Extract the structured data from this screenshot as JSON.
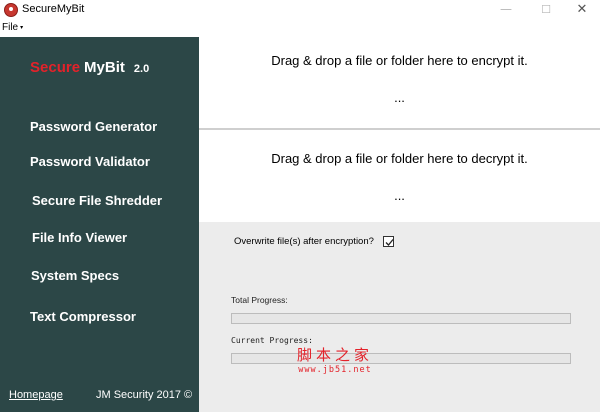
{
  "window": {
    "title": "SecureMyBit",
    "minimize_glyph": "—",
    "maximize_glyph": "☐",
    "close_glyph": "✕"
  },
  "menu": {
    "file_label": "File",
    "file_arrow": "▾"
  },
  "sidebar": {
    "brand_part1": "Secure",
    "brand_part2": "MyBit",
    "version": "2.0",
    "items": [
      {
        "label": "Password Generator"
      },
      {
        "label": "Password Validator"
      },
      {
        "label": "Secure File Shredder"
      },
      {
        "label": "File Info Viewer"
      },
      {
        "label": "System Specs"
      },
      {
        "label": "Text Compressor"
      }
    ],
    "homepage_label": "Homepage",
    "copyright": "JM Security 2017 ©"
  },
  "encrypt_zone": {
    "text": "Drag & drop a file or folder here to encrypt it.",
    "status": "..."
  },
  "decrypt_zone": {
    "text": "Drag & drop a file or folder here to decrypt it.",
    "status": "..."
  },
  "options": {
    "overwrite_label": "Overwrite file(s) after encryption?",
    "overwrite_checked": true
  },
  "progress": {
    "total_label": "Total Progress:",
    "total_value": 0,
    "current_label": "Current Progress:",
    "current_value": 0
  },
  "watermark": {
    "chinese": "脚本之家",
    "url": "www.jb51.net"
  },
  "colors": {
    "sidebar_bg": "#2c4747",
    "brand_red": "#e3222a",
    "panel_bg": "#ececec"
  }
}
